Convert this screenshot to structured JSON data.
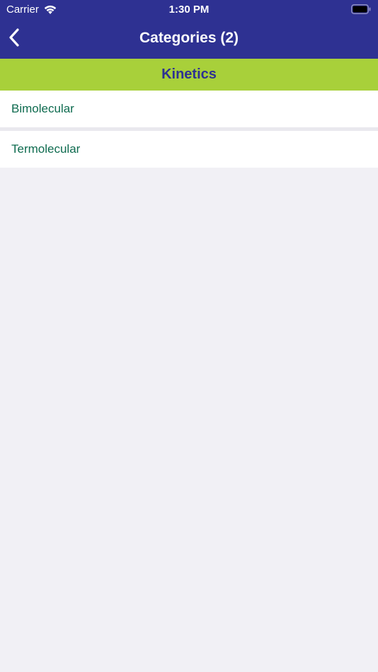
{
  "status_bar": {
    "carrier": "Carrier",
    "time": "1:30 PM",
    "wifi_icon": "wifi-icon",
    "battery_icon": "battery-icon"
  },
  "nav": {
    "title": "Categories (2)",
    "back_icon": "chevron-left-icon"
  },
  "section": {
    "title": "Kinetics"
  },
  "items": [
    {
      "label": "Bimolecular"
    },
    {
      "label": "Termolecular"
    }
  ],
  "colors": {
    "nav_background": "#2e3192",
    "section_background": "#a8d03a",
    "section_text": "#2e3192",
    "item_text": "#0e6b4f",
    "page_background": "#f1f0f5"
  }
}
